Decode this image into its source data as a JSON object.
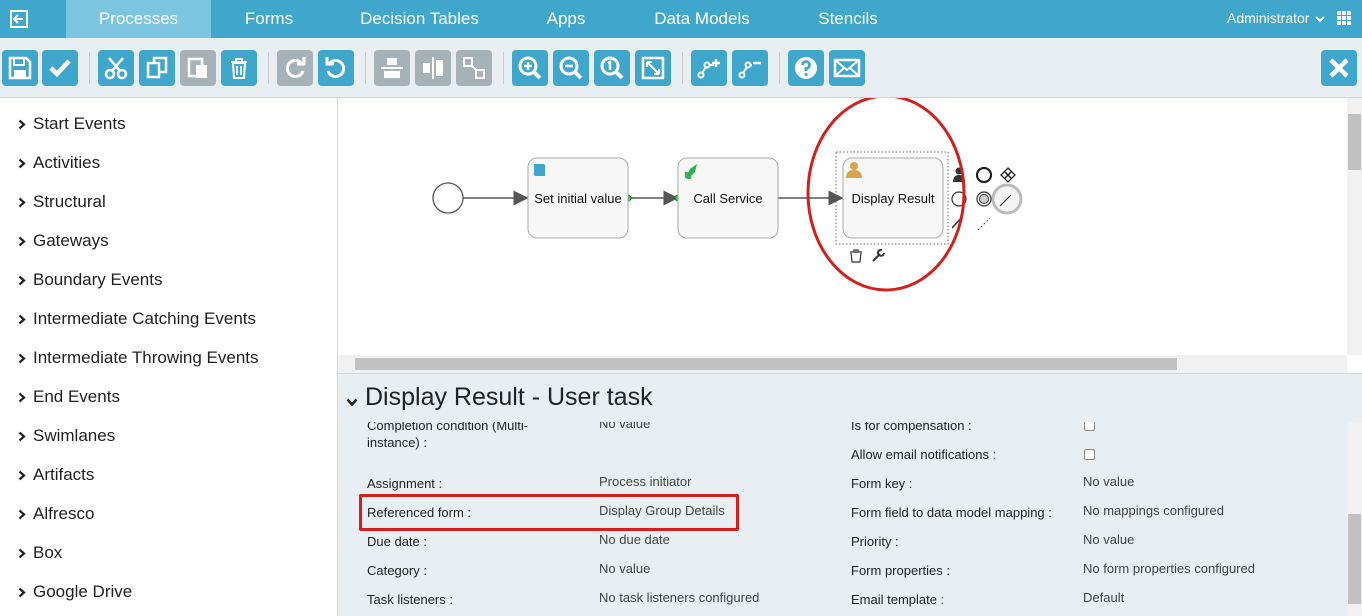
{
  "nav": {
    "tabs": [
      {
        "label": "Processes",
        "active": true
      },
      {
        "label": "Forms"
      },
      {
        "label": "Decision Tables"
      },
      {
        "label": "Apps"
      },
      {
        "label": "Data Models"
      },
      {
        "label": "Stencils"
      }
    ],
    "user": "Administrator",
    "icons": [
      "back-arrow-icon",
      "chevron-down-icon",
      "grid-menu-icon"
    ]
  },
  "toolbar": {
    "buttons": [
      {
        "icon": "save-icon"
      },
      {
        "icon": "validate-check-icon"
      },
      {
        "icon": "cut-icon"
      },
      {
        "icon": "copy-icon"
      },
      {
        "icon": "paste-icon",
        "disabled": true
      },
      {
        "icon": "delete-icon"
      },
      {
        "icon": "redo-icon",
        "disabled": true
      },
      {
        "icon": "undo-icon"
      },
      {
        "icon": "align-vertical-icon",
        "disabled": true
      },
      {
        "icon": "align-horizontal-icon",
        "disabled": true
      },
      {
        "icon": "same-size-icon",
        "disabled": true
      },
      {
        "icon": "zoom-in-icon"
      },
      {
        "icon": "zoom-out-icon"
      },
      {
        "icon": "zoom-actual-icon"
      },
      {
        "icon": "zoom-fit-icon"
      },
      {
        "icon": "add-bendpoint-icon"
      },
      {
        "icon": "remove-bendpoint-icon"
      },
      {
        "icon": "help-icon"
      },
      {
        "icon": "feedback-mail-icon"
      },
      {
        "icon": "close-icon"
      }
    ]
  },
  "palette": {
    "items": [
      "Start Events",
      "Activities",
      "Structural",
      "Gateways",
      "Boundary Events",
      "Intermediate Catching Events",
      "Intermediate Throwing Events",
      "End Events",
      "Swimlanes",
      "Artifacts",
      "Alfresco",
      "Box",
      "Google Drive"
    ]
  },
  "diagram": {
    "tasks": [
      {
        "label": "Set initial value",
        "icon": "script-task-icon"
      },
      {
        "label": "Call Service",
        "icon": "service-task-icon"
      },
      {
        "label": "Display Result",
        "icon": "user-task-icon",
        "selected": true
      }
    ],
    "highlight_color": "#d41f1f"
  },
  "properties": {
    "title": "Display Result - User task",
    "left": [
      {
        "label": "Completion condition (Multi-instance) :",
        "value": "No value"
      },
      {
        "label": "Assignment :",
        "value": "Process initiator"
      },
      {
        "label": "Referenced form :",
        "value": "Display Group Details"
      },
      {
        "label": "Due date :",
        "value": "No due date"
      },
      {
        "label": "Category :",
        "value": "No value"
      },
      {
        "label": "Task listeners :",
        "value": "No task listeners configured"
      }
    ],
    "right": [
      {
        "label": "Is for compensation :",
        "value": ""
      },
      {
        "label": "Allow email notifications :",
        "value": ""
      },
      {
        "label": "Form key :",
        "value": "No value"
      },
      {
        "label": "Form field to data model mapping :",
        "value": "No mappings configured"
      },
      {
        "label": "Priority :",
        "value": "No value"
      },
      {
        "label": "Form properties :",
        "value": "No form properties configured"
      },
      {
        "label": "Email template :",
        "value": "Default"
      }
    ]
  },
  "colors": {
    "brand": "#3fa6cc",
    "active_tab": "#7cc5e0",
    "highlight": "#d41f1f"
  }
}
